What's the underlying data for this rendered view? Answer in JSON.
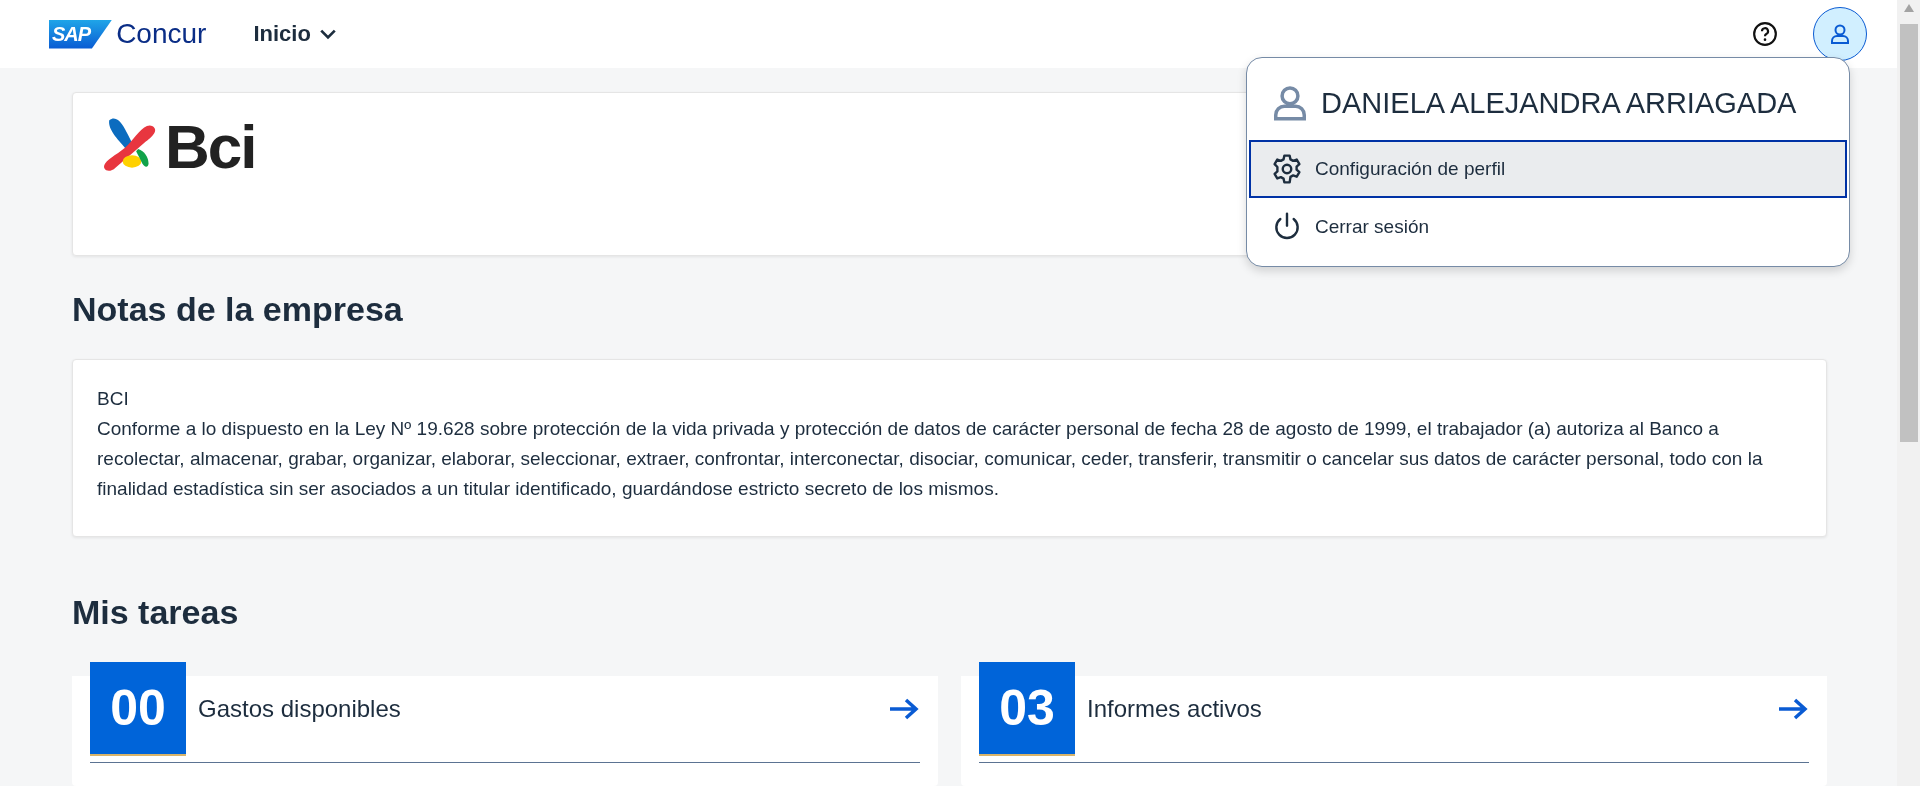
{
  "header": {
    "brand": "Concur",
    "brand_badge": "SAP",
    "nav": {
      "label": "Inicio",
      "expanded": false
    }
  },
  "company_logo": {
    "text": "Bci"
  },
  "notes": {
    "heading": "Notas de la empresa",
    "title": "BCI",
    "body": "Conforme a lo dispuesto en la Ley Nº 19.628 sobre protección de la vida privada y protección de datos de carácter personal de fecha 28 de agosto de 1999, el trabajador (a) autoriza al Banco a recolectar, almacenar, grabar, organizar, elaborar, seleccionar, extraer, confrontar, interconectar, disociar, comunicar, ceder, transferir, transmitir o cancelar sus datos de carácter personal, todo con la finalidad estadística sin ser asociados a un titular identificado, guardándose estricto secreto de los mismos."
  },
  "tasks": {
    "heading": "Mis tareas",
    "cards": [
      {
        "count": "00",
        "label": "Gastos disponibles"
      },
      {
        "count": "03",
        "label": "Informes activos"
      }
    ]
  },
  "user_menu": {
    "user_name": "DANIELA ALEJANDRA ARRIAGADA",
    "items": [
      {
        "kind": "settings",
        "label": "Configuración de perfil",
        "selected": true
      },
      {
        "kind": "logout",
        "label": "Cerrar sesión",
        "selected": false
      }
    ]
  }
}
